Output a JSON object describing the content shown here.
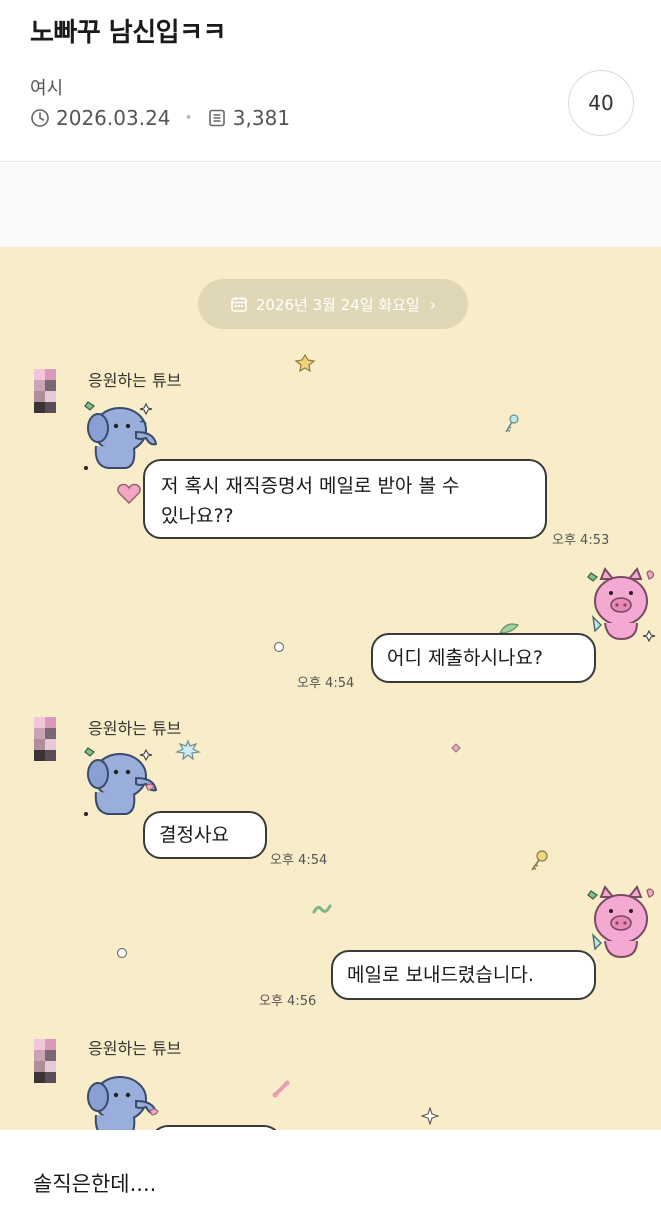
{
  "post": {
    "title": "노빠꾸 남신입ㅋㅋ",
    "author": "여시",
    "date": "2026.03.24",
    "views": "3,381",
    "comment_count": "40"
  },
  "chat": {
    "date_pill": "2026년 3월 24일 화요일",
    "messages": [
      {
        "sender": "응원하는 튜브",
        "side": "left",
        "text_line1": "저 혹시 재직증명서 메일로 받아 볼 수",
        "text_line2": "있나요??",
        "time": "오후 4:53"
      },
      {
        "side": "right",
        "text": "어디 제출하시나요?",
        "time": "오후 4:54"
      },
      {
        "sender": "응원하는 튜브",
        "side": "left",
        "text": "결정사요",
        "time": "오후 4:54"
      },
      {
        "side": "right",
        "text": "메일로 보내드렸습니다.",
        "time": "오후 4:56"
      },
      {
        "sender": "응원하는 튜브",
        "side": "left"
      }
    ]
  },
  "caption": "솔직은한데....",
  "colors": {
    "chat_background": "#f8edc8",
    "date_pill": "#e0d7b6",
    "elephant": "#9aaedb",
    "pig": "#f4a9d2"
  },
  "icons": [
    "clock-icon",
    "document-icon",
    "calendar-icon",
    "chevron-right-icon",
    "elephant-sticker",
    "pig-sticker",
    "heart-icon"
  ]
}
